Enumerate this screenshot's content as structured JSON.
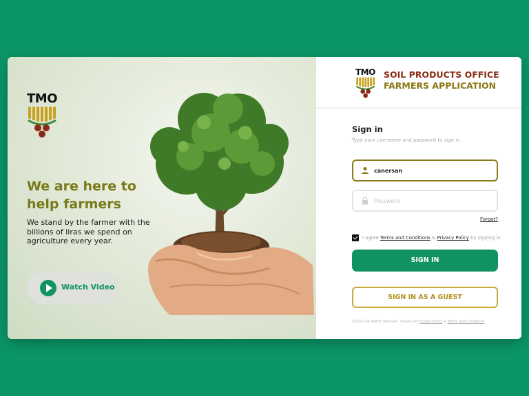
{
  "brand": {
    "logo_text": "TMO",
    "office_line1": "SOIL PRODUCTS OFFICE",
    "office_line2": "FARMERS APPLICATION"
  },
  "hero": {
    "title": "We are here to help farmers",
    "subtitle": "We stand by the farmer with the billions of liras we spend on agriculture every year.",
    "video_button": "Watch Video"
  },
  "signin": {
    "title": "Sign in",
    "hint": "Type your username and password to sign in.",
    "username_value": "canersan",
    "password_placeholder": "Password",
    "forgot": "Forgot?",
    "agree_prefix": "I agree",
    "terms_link": "Terms and Conditions",
    "amp": "&",
    "privacy_link": "Privacy Policy",
    "agree_suffix": "by signing in.",
    "agree_checked": true,
    "submit": "SIGN IN",
    "guest": "SIGN IN AS A GUEST"
  },
  "footer": {
    "copyright": "©2021 All Rights reserved. Tesgis.com",
    "cookie": "Cookie Policy",
    "amp": "&",
    "terms": "Terms and Conditions"
  },
  "colors": {
    "background": "#0b9466",
    "primary": "#119261",
    "gold": "#c8a93a",
    "brand_red": "#8a2e14",
    "hero_title": "#7a7a1a"
  },
  "icons": {
    "play": "play-icon",
    "user": "user-icon",
    "lock": "lock-icon",
    "check": "checkbox-checked"
  }
}
